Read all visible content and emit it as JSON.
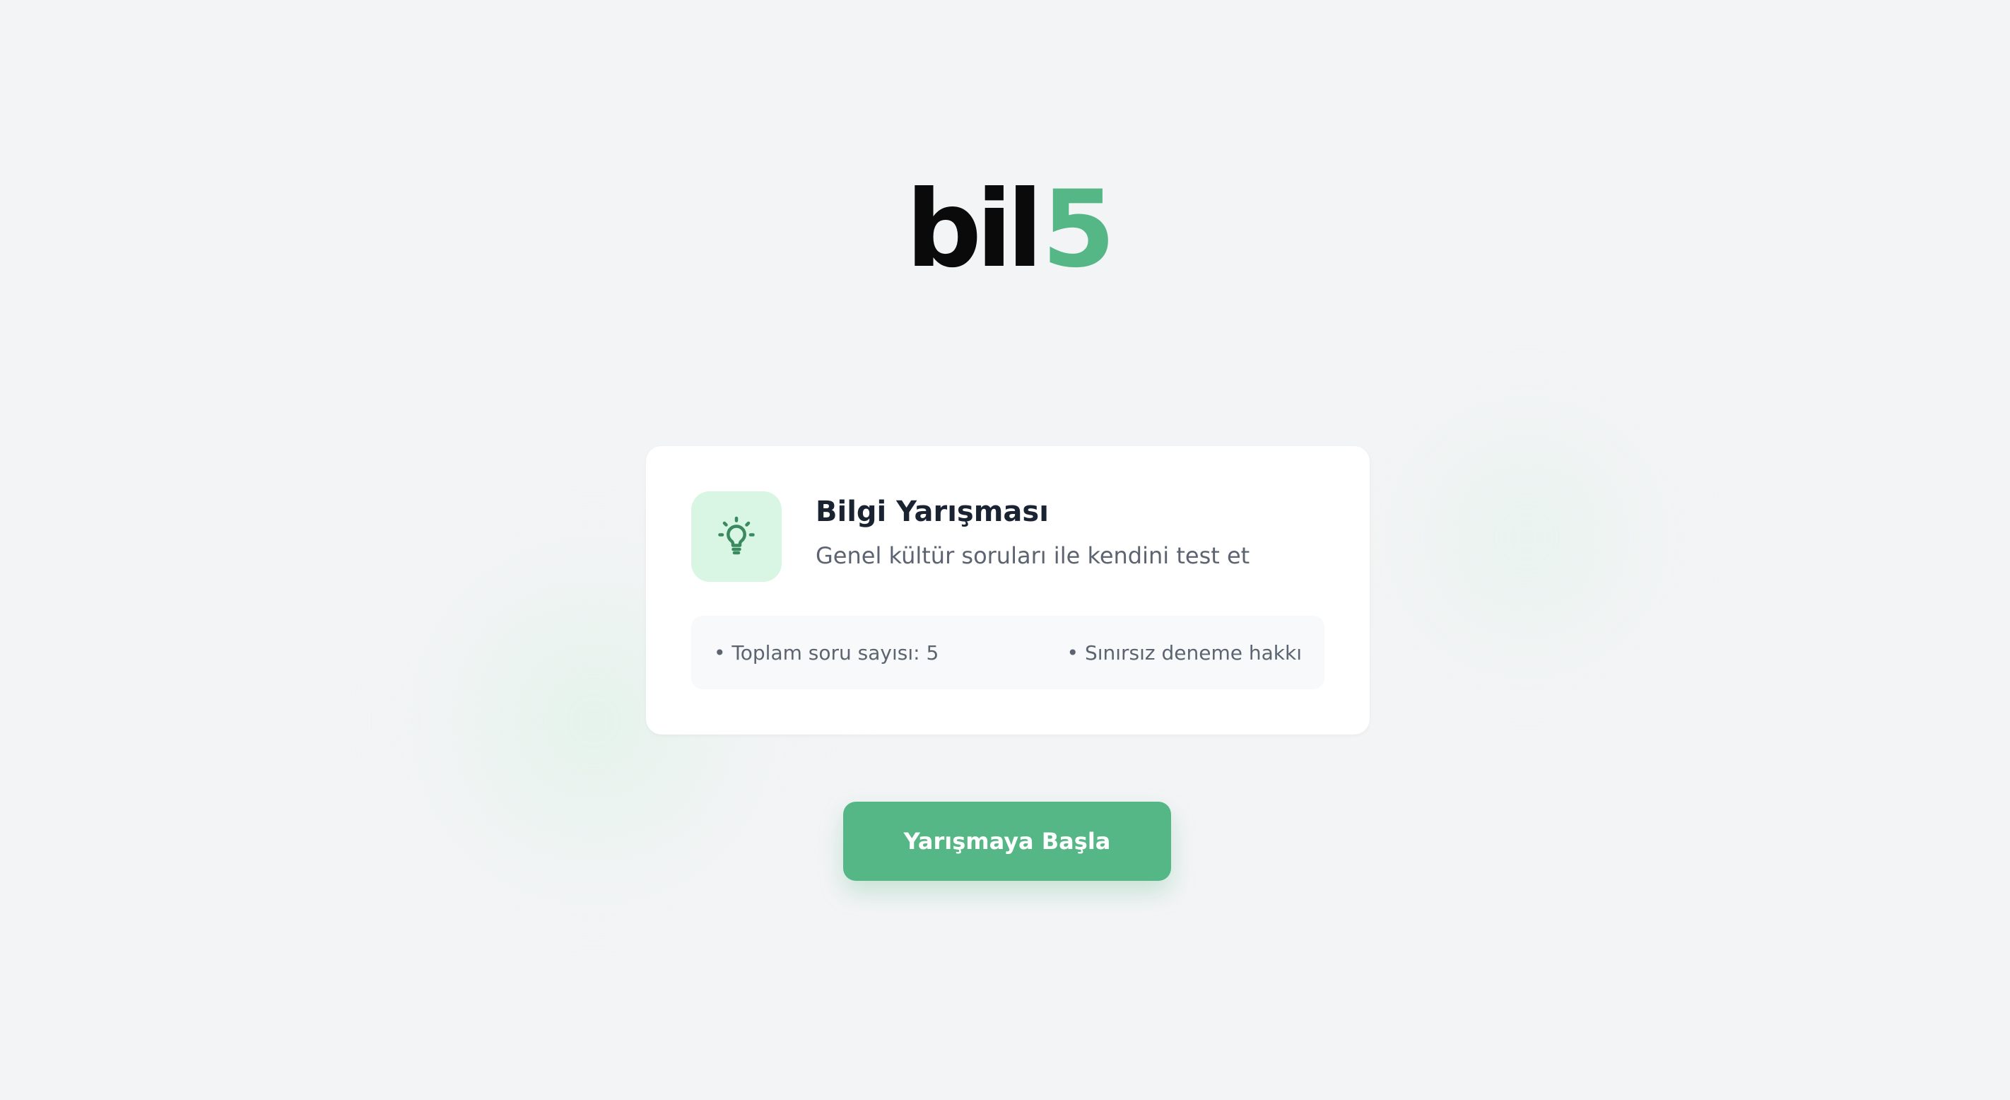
{
  "logo": {
    "text_main": "bil",
    "text_accent": "5"
  },
  "card": {
    "icon": "lightbulb-icon",
    "title": "Bilgi Yarışması",
    "subtitle": "Genel kültür soruları ile kendini test et",
    "info": [
      {
        "text": "• Toplam soru sayısı: 5"
      },
      {
        "text": "• Sınırsız deneme hakkı"
      }
    ]
  },
  "start_button": {
    "label": "Yarışmaya Başla"
  },
  "colors": {
    "accent": "#55b785",
    "icon_bg": "#d9f5e3",
    "icon_fg": "#3a8a60",
    "background": "#f3f4f6",
    "title": "#1a2332",
    "muted_text": "#5b6470"
  }
}
